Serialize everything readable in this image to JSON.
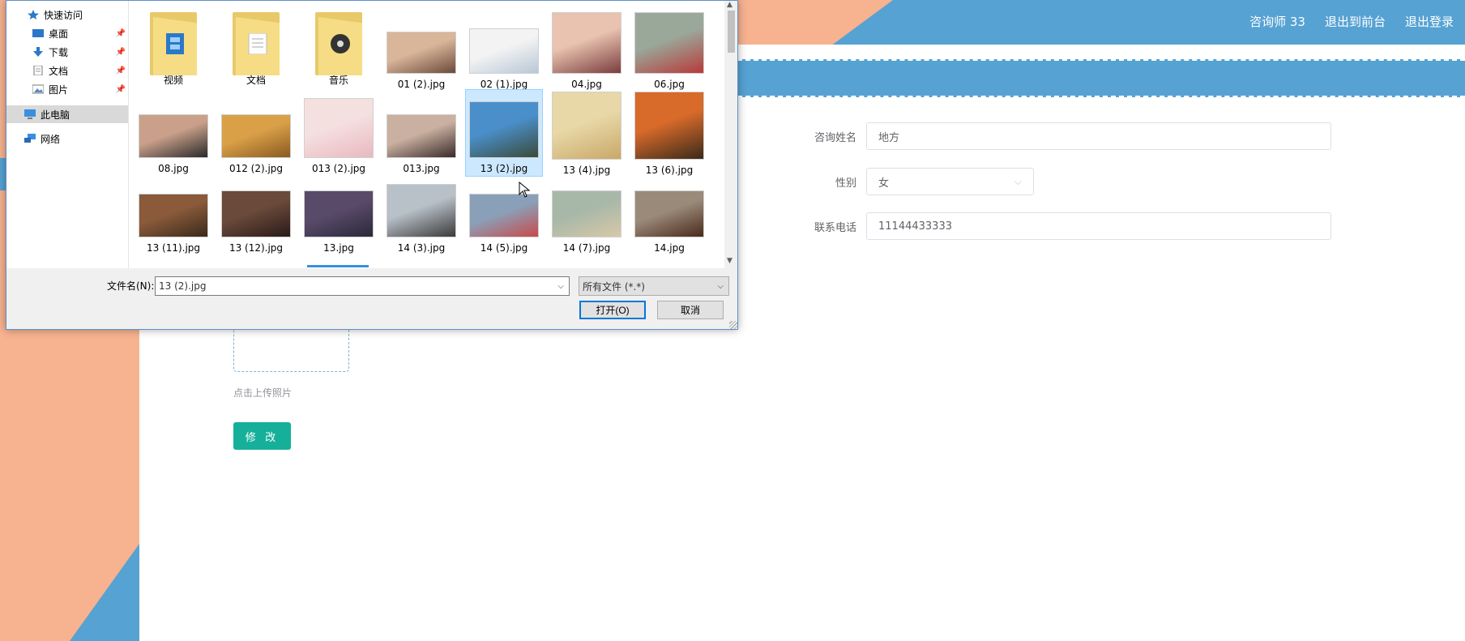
{
  "header": {
    "nav": [
      "咨询师 33",
      "退出到前台",
      "退出登录"
    ]
  },
  "form": {
    "name_label": "咨询姓名",
    "name_value": "地方",
    "gender_label": "性别",
    "gender_value": "女",
    "phone_label": "联系电话",
    "phone_value": "11144433333",
    "upload_hint": "点击上传照片",
    "modify_button": "修 改"
  },
  "colors": {
    "brand_blue": "#56a2d3",
    "peach": "#f7b28f",
    "teal_button": "#16b09a"
  },
  "dialog": {
    "nav": [
      {
        "label": "快速访问",
        "icon": "star-icon",
        "pinned": false
      },
      {
        "label": "桌面",
        "icon": "desktop-icon",
        "pinned": true
      },
      {
        "label": "下载",
        "icon": "download-icon",
        "pinned": true
      },
      {
        "label": "文档",
        "icon": "document-icon",
        "pinned": true
      },
      {
        "label": "图片",
        "icon": "picture-icon",
        "pinned": true
      },
      {
        "label": "此电脑",
        "icon": "computer-icon",
        "pinned": false
      },
      {
        "label": "网络",
        "icon": "network-icon",
        "pinned": false
      }
    ],
    "files": [
      {
        "name": "视频",
        "kind": "folder",
        "mark": "video"
      },
      {
        "name": "文档",
        "kind": "folder",
        "mark": "docs"
      },
      {
        "name": "音乐",
        "kind": "folder",
        "mark": "music"
      },
      {
        "name": "01 (2).jpg",
        "kind": "image",
        "tone": [
          "#d9b59a",
          "#6b4a3a"
        ]
      },
      {
        "name": "02 (1).jpg",
        "kind": "image",
        "tone": [
          "#f3f3f3",
          "#b8c7d6"
        ]
      },
      {
        "name": "04.jpg",
        "kind": "image",
        "tone": [
          "#e9c3b0",
          "#7a3d3d"
        ]
      },
      {
        "name": "06.jpg",
        "kind": "image",
        "tone": [
          "#9aa89a",
          "#b83a3a"
        ]
      },
      {
        "name": "08.jpg",
        "kind": "image",
        "tone": [
          "#caa08a",
          "#2a2a2a"
        ]
      },
      {
        "name": "012 (2).jpg",
        "kind": "image",
        "tone": [
          "#d9a048",
          "#8a5a20"
        ]
      },
      {
        "name": "013 (2).jpg",
        "kind": "image",
        "tone": [
          "#f5e0e0",
          "#e8b8c0"
        ]
      },
      {
        "name": "013.jpg",
        "kind": "image",
        "tone": [
          "#c9b0a0",
          "#3a2a2a"
        ]
      },
      {
        "name": "13 (2).jpg",
        "kind": "image",
        "tone": [
          "#4a8fc9",
          "#3a4a3a"
        ]
      },
      {
        "name": "13 (4).jpg",
        "kind": "image",
        "tone": [
          "#e8d8a8",
          "#c9a868"
        ]
      },
      {
        "name": "13 (6).jpg",
        "kind": "image",
        "tone": [
          "#d86a2a",
          "#3a2a1a"
        ]
      },
      {
        "name": "13 (11).jpg",
        "kind": "image",
        "tone": [
          "#8a5a3a",
          "#3a2a1a"
        ]
      },
      {
        "name": "13 (12).jpg",
        "kind": "image",
        "tone": [
          "#6a4a3a",
          "#2a1a1a"
        ]
      },
      {
        "name": "13.jpg",
        "kind": "image",
        "tone": [
          "#5a4a6a",
          "#2a2a3a"
        ]
      },
      {
        "name": "14 (3).jpg",
        "kind": "image",
        "tone": [
          "#b8c0c8",
          "#3a3a3a"
        ]
      },
      {
        "name": "14 (5).jpg",
        "kind": "image",
        "tone": [
          "#8aa0b8",
          "#c84a4a"
        ]
      },
      {
        "name": "14 (7).jpg",
        "kind": "image",
        "tone": [
          "#a8b8a8",
          "#d8c8a8"
        ]
      },
      {
        "name": "14.jpg",
        "kind": "image",
        "tone": [
          "#9a8a7a",
          "#4a2a1a"
        ]
      }
    ],
    "selected_file": "13 (2).jpg",
    "filename_label": "文件名(N):",
    "filename_value": "13 (2).jpg",
    "filetype_value": "所有文件 (*.*)",
    "open_button": "打开(O)",
    "cancel_button": "取消"
  }
}
